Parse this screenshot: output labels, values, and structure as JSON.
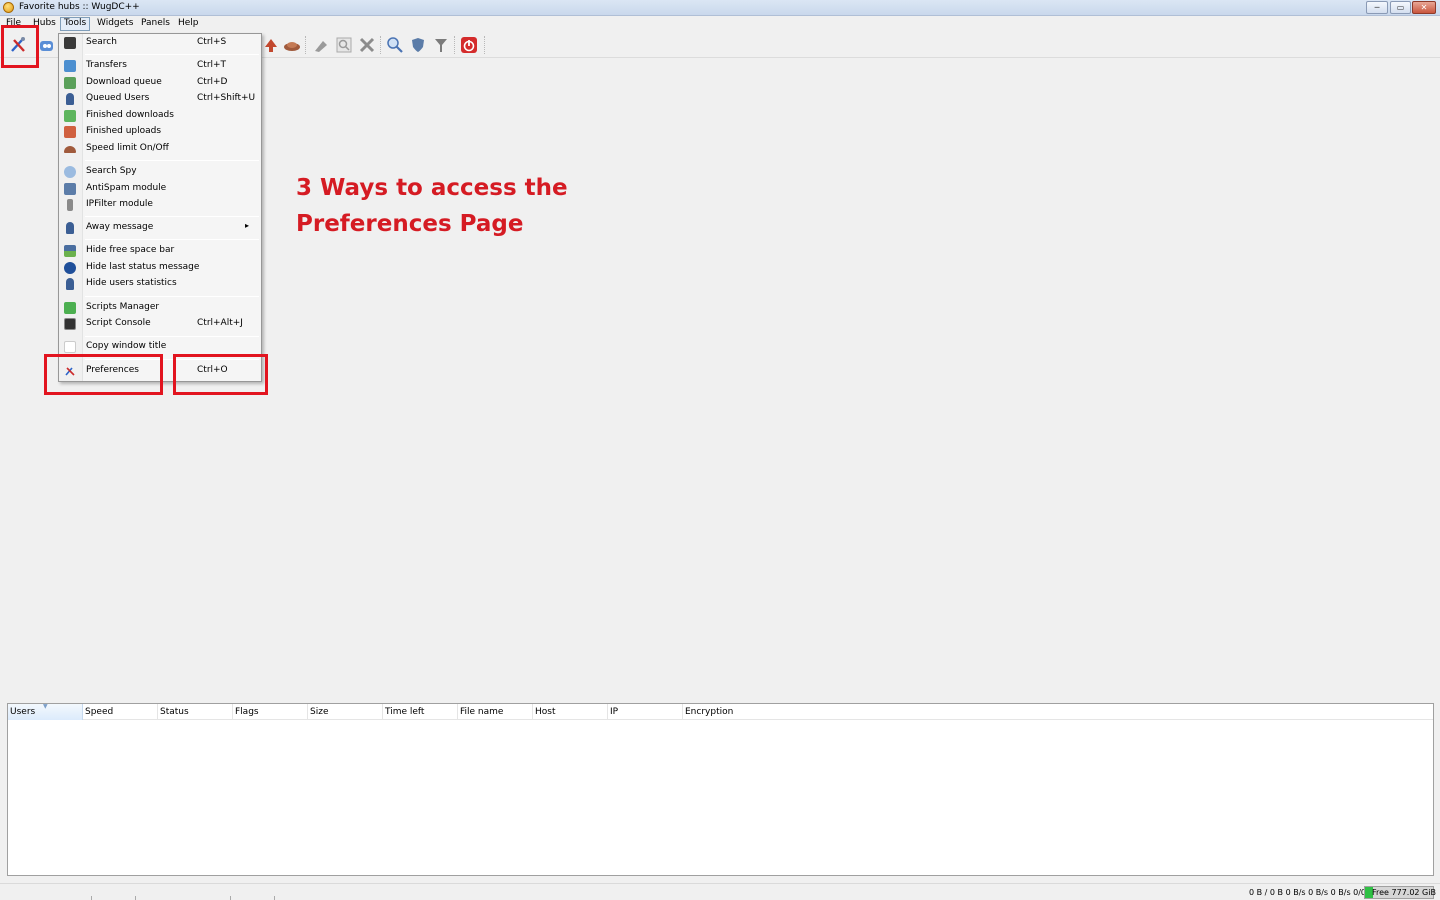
{
  "window": {
    "title": "Favorite hubs :: WugDC++"
  },
  "window_controls": {
    "minimize": "─",
    "maximize": "▭",
    "close": "✕"
  },
  "menubar": {
    "file": "File",
    "hubs": "Hubs",
    "tools": "Tools",
    "widgets": "Widgets",
    "panels": "Panels",
    "help": "Help"
  },
  "toolbar": {
    "icons": [
      "preferences-icon",
      "public-hubs-icon",
      "finished-uploads-icon",
      "speed-limit-icon",
      "clear-icon",
      "search-icon",
      "close-icon",
      "search-spy-icon",
      "antispam-icon",
      "ipfilter-icon",
      "shutdown-icon"
    ]
  },
  "tools_menu": {
    "items": [
      {
        "label": "Search",
        "shortcut": "Ctrl+S",
        "icon": "binoculars-icon"
      },
      {
        "label": "Transfers",
        "shortcut": "Ctrl+T",
        "icon": "transfers-icon"
      },
      {
        "label": "Download queue",
        "shortcut": "Ctrl+D",
        "icon": "download-queue-icon"
      },
      {
        "label": "Queued Users",
        "shortcut": "Ctrl+Shift+U",
        "icon": "queued-users-icon"
      },
      {
        "label": "Finished downloads",
        "shortcut": "",
        "icon": "finished-downloads-icon"
      },
      {
        "label": "Finished uploads",
        "shortcut": "",
        "icon": "finished-uploads-icon"
      },
      {
        "label": "Speed limit On/Off",
        "shortcut": "",
        "icon": "speed-limit-icon"
      },
      {
        "label": "Search Spy",
        "shortcut": "",
        "icon": "search-spy-icon"
      },
      {
        "label": "AntiSpam module",
        "shortcut": "",
        "icon": "antispam-icon"
      },
      {
        "label": "IPFilter module",
        "shortcut": "",
        "icon": "ipfilter-icon"
      },
      {
        "label": "Away message",
        "shortcut": "",
        "icon": "away-icon",
        "submenu": "▸"
      },
      {
        "label": "Hide free space bar",
        "shortcut": "",
        "icon": "free-space-icon"
      },
      {
        "label": "Hide last status message",
        "shortcut": "",
        "icon": "info-icon"
      },
      {
        "label": "Hide users statistics",
        "shortcut": "",
        "icon": "user-stats-icon"
      },
      {
        "label": "Scripts Manager",
        "shortcut": "",
        "icon": "scripts-manager-icon"
      },
      {
        "label": "Script Console",
        "shortcut": "Ctrl+Alt+J",
        "icon": "script-console-icon"
      },
      {
        "label": "Copy window title",
        "shortcut": "",
        "icon": "copy-icon"
      },
      {
        "label": "Preferences",
        "shortcut": "Ctrl+O",
        "icon": "preferences-icon"
      }
    ]
  },
  "annotation": {
    "line1": "3 Ways to access the",
    "line2": "Preferences Page",
    "color": "#d51b23"
  },
  "transfers": {
    "columns": [
      "Users",
      "Speed",
      "Status",
      "Flags",
      "Size",
      "Time left",
      "File name",
      "Host",
      "IP",
      "Encryption"
    ]
  },
  "statusbar": {
    "transfer_stats": "0 B / 0 B  0 B/s  0 B/s  0 B/s  0/0/0",
    "free_space": "Free 777.02 GiB"
  }
}
